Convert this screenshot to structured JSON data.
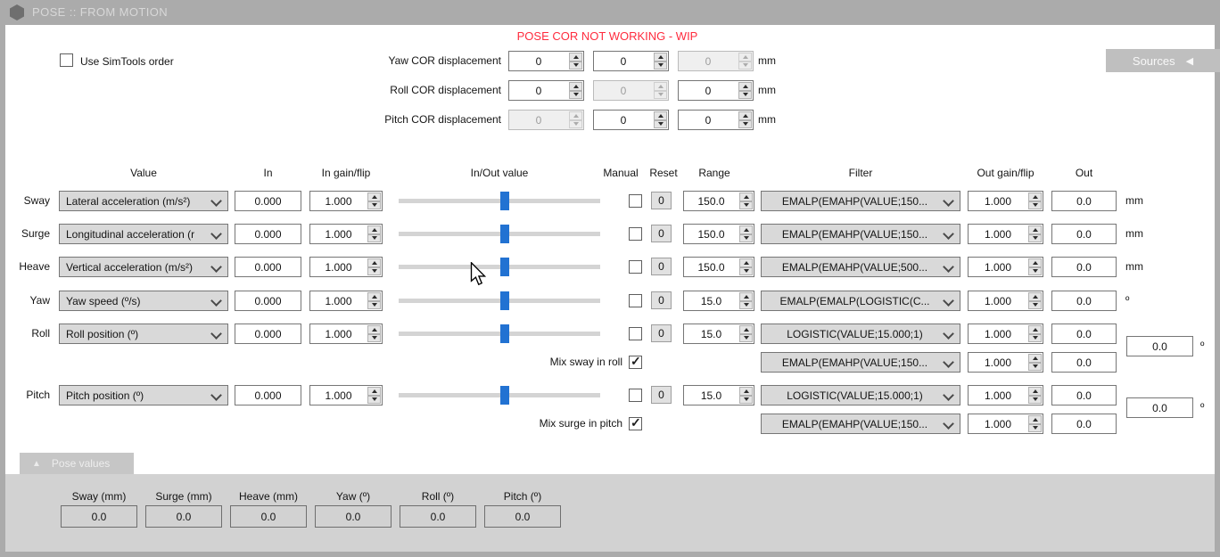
{
  "window": {
    "title": "POSE :: FROM MOTION"
  },
  "top": {
    "warning": "POSE COR NOT WORKING - WIP",
    "use_simtools_label": "Use SimTools order",
    "sources_label": "Sources",
    "cor_unit": "mm",
    "cor_rows": [
      {
        "label": "Yaw COR displacement",
        "x": "0",
        "y": "0",
        "z": "0"
      },
      {
        "label": "Roll COR displacement",
        "x": "0",
        "y": "0",
        "z": "0"
      },
      {
        "label": "Pitch COR displacement",
        "x": "0",
        "y": "0",
        "z": "0"
      }
    ]
  },
  "table": {
    "headers": {
      "value": "Value",
      "in": "In",
      "in_gain": "In gain/flip",
      "inout": "In/Out value",
      "manual": "Manual",
      "reset": "Reset",
      "range": "Range",
      "filter": "Filter",
      "out_gain": "Out gain/flip",
      "out": "Out"
    },
    "reset_label": "0",
    "rows": [
      {
        "name": "Sway",
        "value": "Lateral acceleration (m/s²)",
        "in_value": "0.000",
        "in_gain": "1.000",
        "range": "150.0",
        "filter": "EMALP(EMAHP(VALUE;150...",
        "out_gain": "1.000",
        "out": "0.0",
        "unit": "mm"
      },
      {
        "name": "Surge",
        "value": "Longitudinal acceleration (r",
        "in_value": "0.000",
        "in_gain": "1.000",
        "range": "150.0",
        "filter": "EMALP(EMAHP(VALUE;150...",
        "out_gain": "1.000",
        "out": "0.0",
        "unit": "mm"
      },
      {
        "name": "Heave",
        "value": "Vertical acceleration (m/s²)",
        "in_value": "0.000",
        "in_gain": "1.000",
        "range": "150.0",
        "filter": "EMALP(EMAHP(VALUE;500...",
        "out_gain": "1.000",
        "out": "0.0",
        "unit": "mm"
      },
      {
        "name": "Yaw",
        "value": "Yaw speed (º/s)",
        "in_value": "0.000",
        "in_gain": "1.000",
        "range": "15.0",
        "filter": "EMALP(EMALP(LOGISTIC(C...",
        "out_gain": "1.000",
        "out": "0.0",
        "unit": "º"
      },
      {
        "name": "Roll",
        "value": "Roll position (º)",
        "in_value": "0.000",
        "in_gain": "1.000",
        "range": "15.0",
        "filter": "LOGISTIC(VALUE;15.000;1)",
        "out_gain": "1.000",
        "out": "0.0",
        "unit": ""
      },
      {
        "name": "Pitch",
        "value": "Pitch position (º)",
        "in_value": "0.000",
        "in_gain": "1.000",
        "range": "15.0",
        "filter": "LOGISTIC(VALUE;15.000;1)",
        "out_gain": "1.000",
        "out": "0.0",
        "unit": ""
      }
    ],
    "mix_rows": [
      {
        "label": "Mix sway in roll",
        "filter": "EMALP(EMAHP(VALUE;150...",
        "out_gain": "1.000",
        "out": "0.0"
      },
      {
        "label": "Mix surge in pitch",
        "filter": "EMALP(EMAHP(VALUE;150...",
        "out_gain": "1.000",
        "out": "0.0"
      }
    ],
    "combined": [
      {
        "value": "0.0",
        "unit": "º"
      },
      {
        "value": "0.0",
        "unit": "º"
      }
    ]
  },
  "pose_values": {
    "tab_label": "Pose values",
    "fields": [
      {
        "label": "Sway (mm)",
        "value": "0.0"
      },
      {
        "label": "Surge (mm)",
        "value": "0.0"
      },
      {
        "label": "Heave (mm)",
        "value": "0.0"
      },
      {
        "label": "Yaw (º)",
        "value": "0.0"
      },
      {
        "label": "Roll (º)",
        "value": "0.0"
      },
      {
        "label": "Pitch (º)",
        "value": "0.0"
      }
    ]
  },
  "colors": {
    "accent_blue": "#2272D2",
    "warning_red": "#FF2C3E",
    "frame_gray": "#ABABAB",
    "panel_gray": "#D2D2D2",
    "control_gray": "#D9D9D9"
  }
}
